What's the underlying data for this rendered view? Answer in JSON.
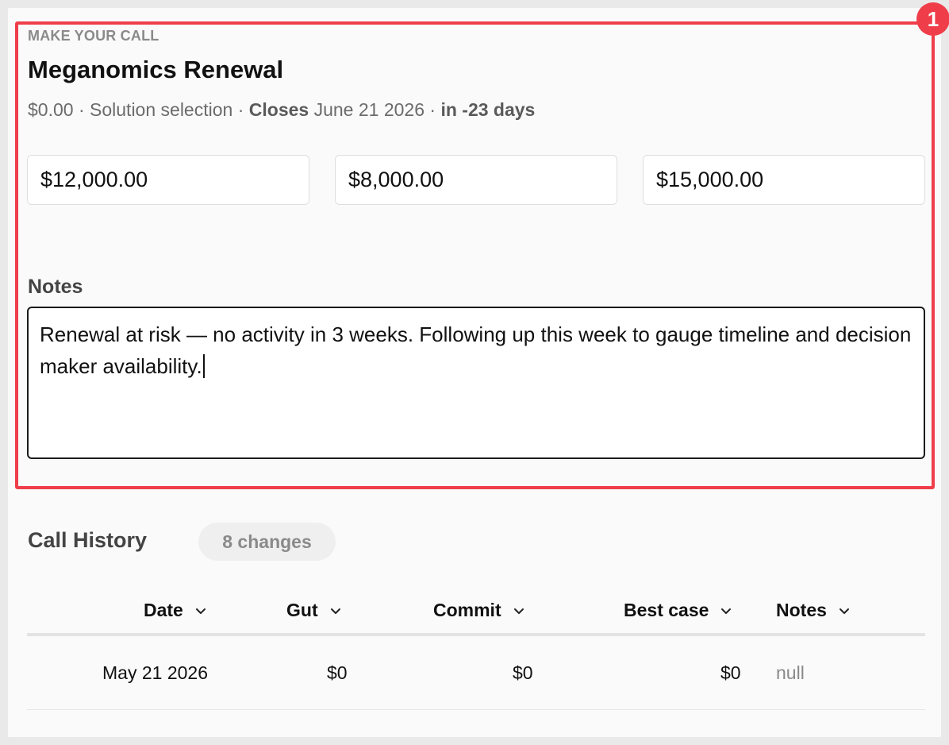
{
  "call": {
    "eyebrow": "MAKE YOUR CALL",
    "title": "Meganomics Renewal",
    "meta": {
      "amount": "$0.00",
      "sep1": " · ",
      "stage": "Solution selection",
      "sep2": " · ",
      "closes_label": "Closes",
      "close_date": " June 21 2026",
      "sep3": " · ",
      "in_days": "in -23 days"
    },
    "gut_value": "$12,000.00",
    "commit_value": "$8,000.00",
    "best_case_value": "$15,000.00",
    "notes_label": "Notes",
    "notes_value": "Renewal at risk — no activity in 3 weeks. Following up this week to gauge timeline and decision maker availability."
  },
  "highlight": {
    "badge": "1",
    "color": "#ef3e4a"
  },
  "history": {
    "title": "Call History",
    "changes_badge": "8 changes",
    "columns": [
      "Date",
      "Gut",
      "Commit",
      "Best case",
      "Notes"
    ],
    "rows": [
      {
        "date": "May 21 2026",
        "gut": "$0",
        "commit": "$0",
        "best_case": "$0",
        "notes": "null"
      }
    ]
  },
  "icons": {
    "sort": "chevron-down-icon"
  }
}
